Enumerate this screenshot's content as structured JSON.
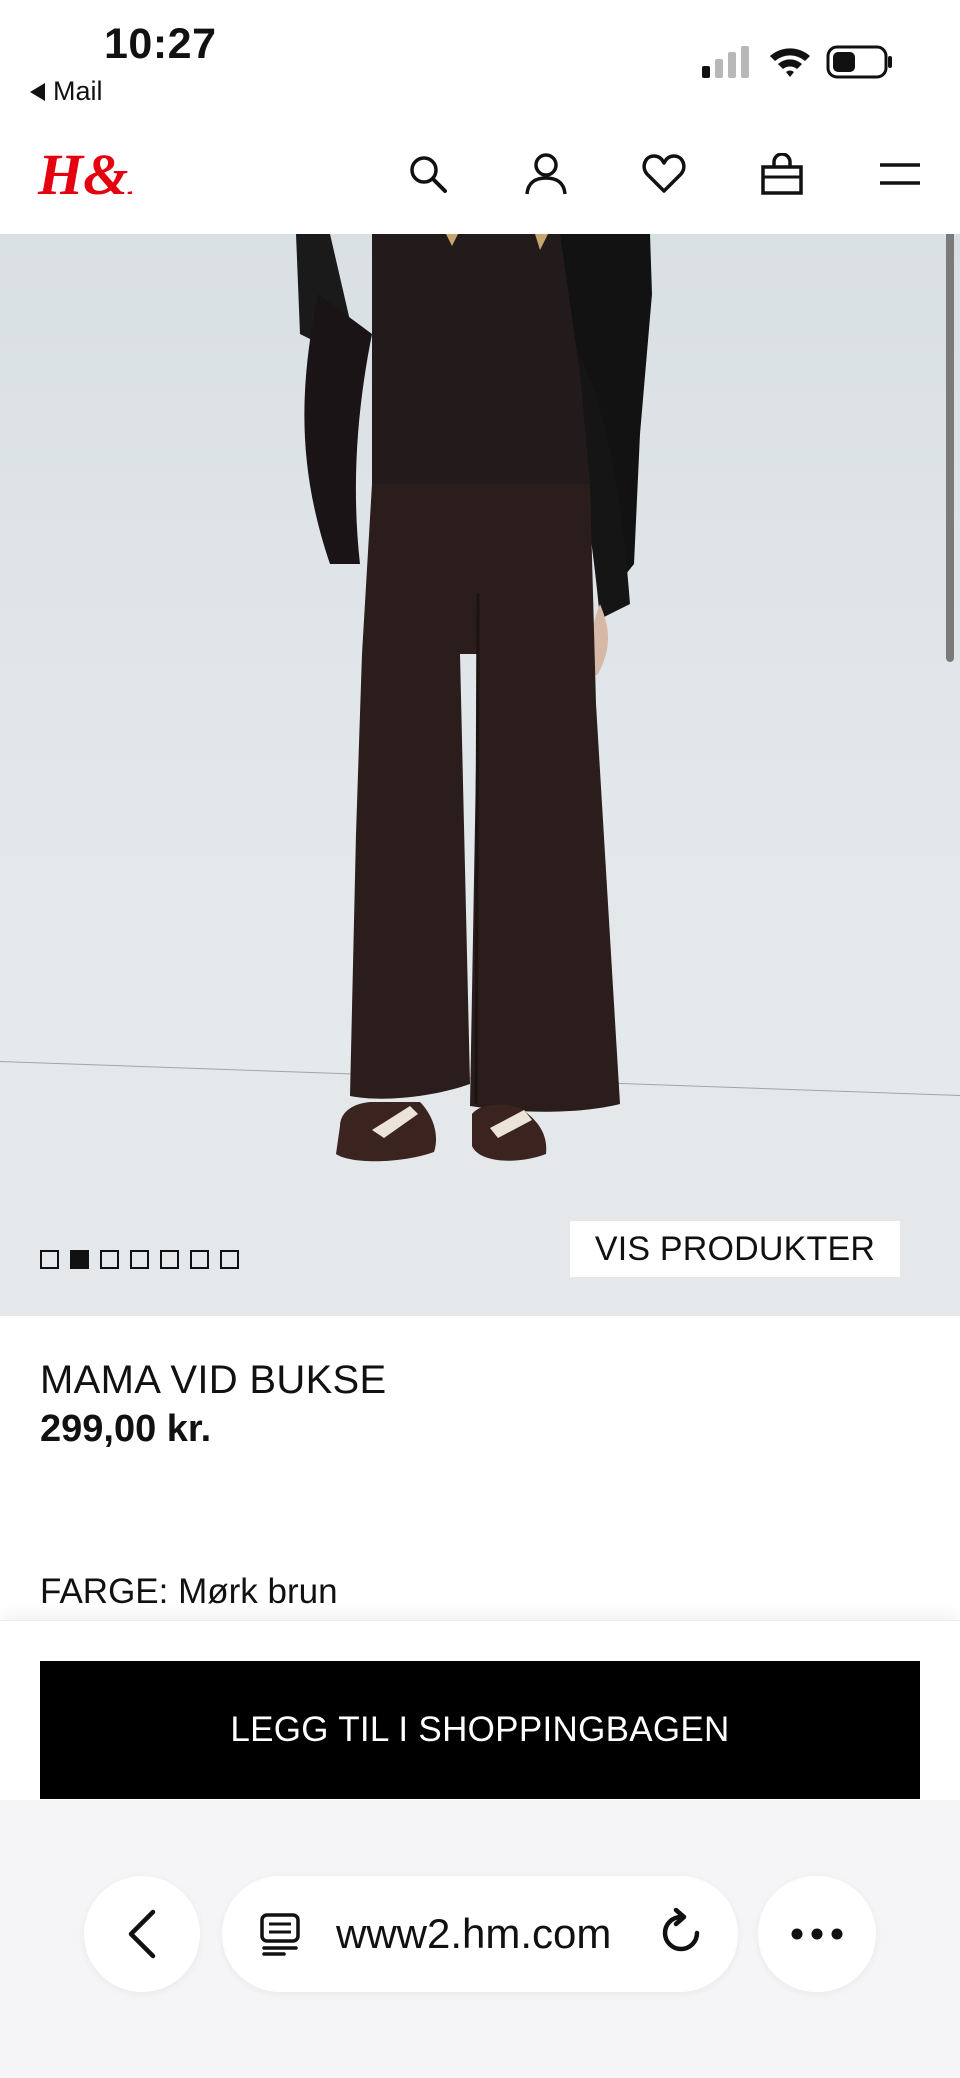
{
  "status_bar": {
    "time": "10:27",
    "back_app": "Mail",
    "signal_icon": "cellular-signal-icon",
    "wifi_icon": "wifi-icon",
    "battery_icon": "battery-icon"
  },
  "header": {
    "logo_text": "H&M",
    "brand_color": "#e50010",
    "icons": [
      "search-icon",
      "account-icon",
      "favorites-icon",
      "shopping-bag-icon",
      "menu-icon"
    ]
  },
  "gallery": {
    "image_count": 7,
    "active_index": 1,
    "show_products_label": "VIS PRODUKTER"
  },
  "product": {
    "name": "MAMA VID BUKSE",
    "price": "299,00 kr.",
    "color_label": "FARGE: Mørk brun"
  },
  "actions": {
    "add_to_bag_label": "LEGG TIL I SHOPPINGBAGEN"
  },
  "browser": {
    "url": "www2.hm.com",
    "back_icon": "chevron-left-icon",
    "reader_icon": "reader-mode-icon",
    "reload_icon": "reload-icon",
    "more_icon": "more-options-icon"
  }
}
